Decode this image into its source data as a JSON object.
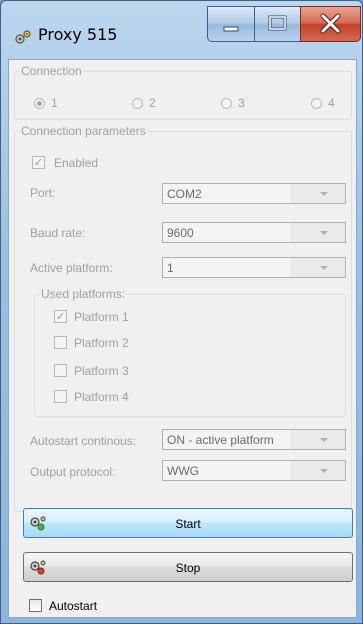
{
  "window": {
    "title": "Proxy 515"
  },
  "connection": {
    "legend": "Connection",
    "options": [
      "1",
      "2",
      "3",
      "4"
    ],
    "selected": "1"
  },
  "params": {
    "legend": "Connection parameters",
    "enabled_label": "Enabled",
    "enabled_checked": true,
    "port_label": "Port:",
    "port_value": "COM2",
    "baud_label": "Baud rate:",
    "baud_value": "9600",
    "active_platform_label": "Active platform:",
    "active_platform_value": "1",
    "used_platforms": {
      "legend": "Used platforms:",
      "items": [
        {
          "label": "Platform 1",
          "checked": true
        },
        {
          "label": "Platform 2",
          "checked": false
        },
        {
          "label": "Platform 3",
          "checked": false
        },
        {
          "label": "Platform 4",
          "checked": false
        }
      ]
    },
    "autostart_continuous_label": "Autostart continous:",
    "autostart_continuous_value": "ON - active platform",
    "output_protocol_label": "Output protocol:",
    "output_protocol_value": "WWG"
  },
  "buttons": {
    "start_label": "Start",
    "stop_label": "Stop"
  },
  "autostart": {
    "label": "Autostart",
    "checked": false
  },
  "icons": {
    "app": "gears-icon",
    "start": "gears-green-icon",
    "stop": "gears-red-icon"
  },
  "colors": {
    "titlebar": "#9dc0e2",
    "close_button": "#c1412a",
    "start_border": "#3c7fb1"
  }
}
